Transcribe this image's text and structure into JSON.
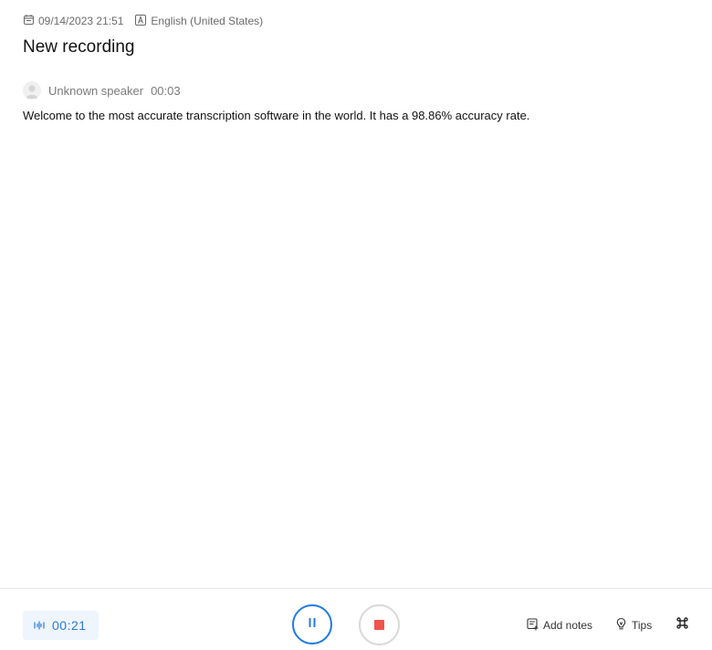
{
  "meta": {
    "datetime": "09/14/2023 21:51",
    "language": "English (United States)"
  },
  "recording": {
    "title": "New recording"
  },
  "transcript": {
    "segments": [
      {
        "speaker": "Unknown speaker",
        "timestamp": "00:03",
        "text": "Welcome to the most accurate transcription software in the world. It has a 98.86% accuracy rate."
      }
    ]
  },
  "footer": {
    "elapsed_time": "00:21",
    "add_notes_label": "Add notes",
    "tips_label": "Tips"
  },
  "colors": {
    "accent": "#1f7ae6",
    "stop": "#f0524c",
    "timer_bg": "#eef5fd"
  },
  "icons": {
    "date": "calendar-icon",
    "language": "language-icon",
    "speaker": "avatar-icon",
    "timer": "waveform-icon",
    "pause": "pause-icon",
    "stop": "stop-icon",
    "notes": "notes-icon",
    "tips": "lightbulb-icon",
    "shortcuts": "command-icon"
  }
}
